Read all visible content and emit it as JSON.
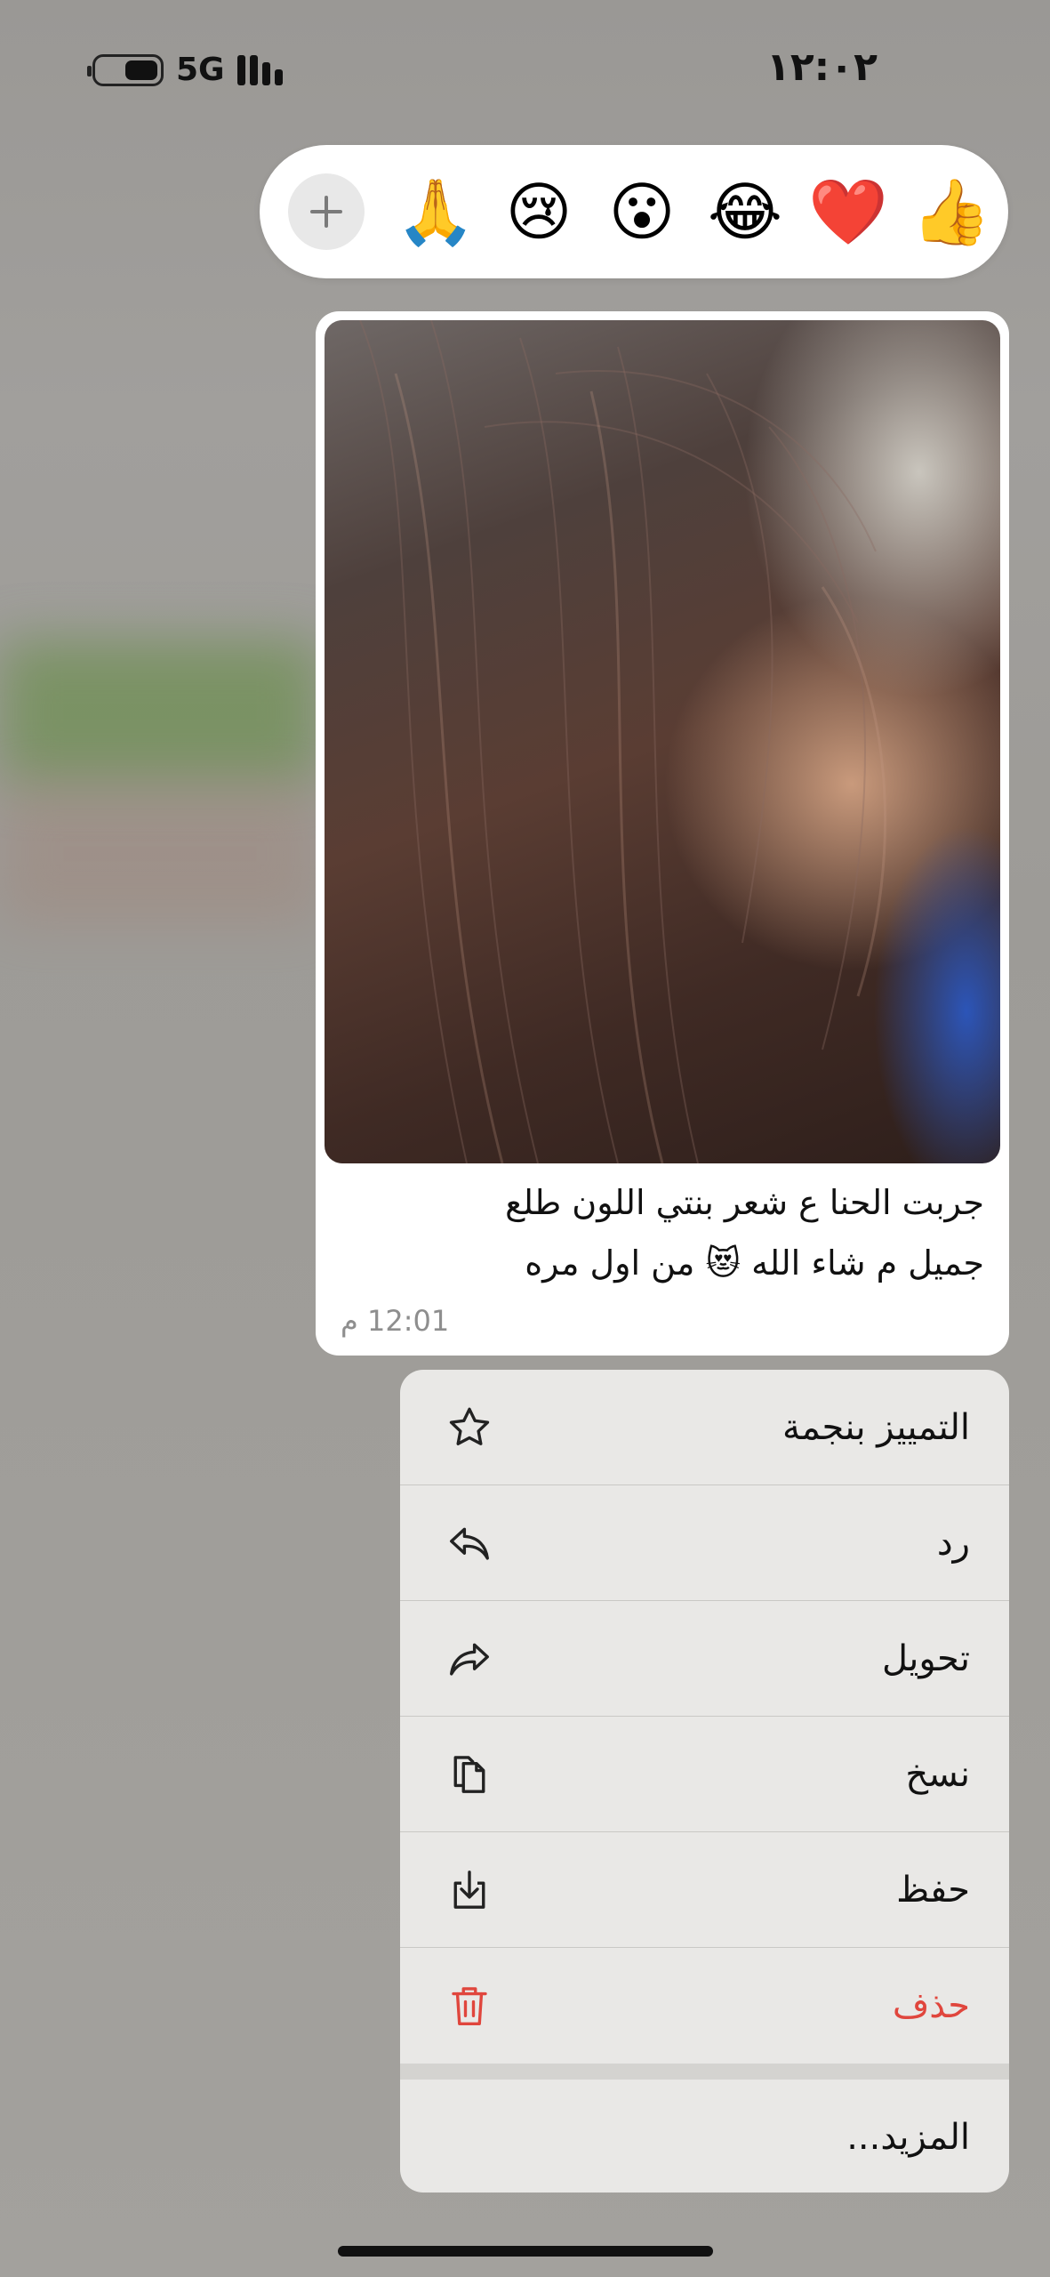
{
  "status_bar": {
    "network": "5G",
    "time": "١٢:٠٢"
  },
  "reactions": {
    "add_symbol": "+",
    "emojis": [
      "🙏",
      "😢",
      "😮",
      "😂",
      "❤️",
      "👍"
    ]
  },
  "message": {
    "caption_line1": "جربت الحنا ع شعر بنتي  اللون طلع",
    "caption_line2": "جميل م شاء الله 😻 من اول مره",
    "time": "12:01 م"
  },
  "menu": {
    "items": [
      {
        "label": "التمييز بنجمة",
        "icon": "star-icon"
      },
      {
        "label": "رد",
        "icon": "reply-icon"
      },
      {
        "label": "تحويل",
        "icon": "forward-icon"
      },
      {
        "label": "نسخ",
        "icon": "copy-icon"
      },
      {
        "label": "حفظ",
        "icon": "save-icon"
      },
      {
        "label": "حذف",
        "icon": "trash-icon"
      }
    ],
    "more_label": "المزيد..."
  },
  "colors": {
    "danger": "#e0463d",
    "menu_bg": "#e9e8e6",
    "bubble_bg": "#ffffff"
  }
}
